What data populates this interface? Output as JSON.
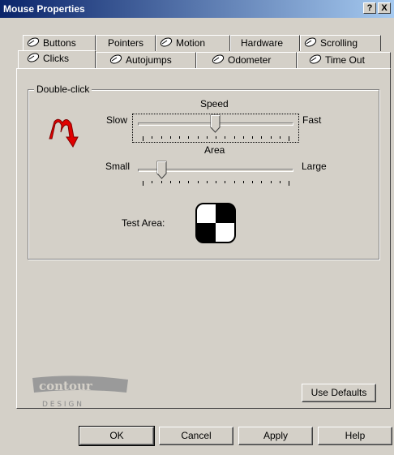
{
  "window": {
    "title": "Mouse Properties",
    "help_label": "?",
    "close_label": "X"
  },
  "tabs_row1": [
    {
      "label": "Buttons",
      "icon": "mouse-icon"
    },
    {
      "label": "Pointers",
      "icon": ""
    },
    {
      "label": "Motion",
      "icon": "mouse-icon"
    },
    {
      "label": "Hardware",
      "icon": ""
    },
    {
      "label": "Scrolling",
      "icon": "mouse-icon"
    }
  ],
  "tabs_row2": [
    {
      "label": "Clicks",
      "icon": "mouse-icon",
      "active": true
    },
    {
      "label": "Autojumps",
      "icon": "mouse-icon"
    },
    {
      "label": "Odometer",
      "icon": "mouse-icon"
    },
    {
      "label": "Time Out",
      "icon": "mouse-icon"
    }
  ],
  "double_click": {
    "group_label": "Double-click",
    "speed": {
      "label": "Speed",
      "min_label": "Slow",
      "max_label": "Fast",
      "tick_count": 17,
      "value_fraction": 0.5
    },
    "area": {
      "label": "Area",
      "min_label": "Small",
      "max_label": "Large",
      "tick_count": 17,
      "value_fraction": 0.1
    },
    "test_area_label": "Test Area:"
  },
  "logo": {
    "brand": "contour",
    "tagline": "D E S I G N"
  },
  "buttons": {
    "use_defaults": "Use Defaults",
    "ok": "OK",
    "cancel": "Cancel",
    "apply": "Apply",
    "help": "Help"
  },
  "colors": {
    "titlebar_start": "#0a246a",
    "titlebar_end": "#a6caf0",
    "face": "#d4d0c8",
    "dblclick_arrow": "#e00000"
  }
}
